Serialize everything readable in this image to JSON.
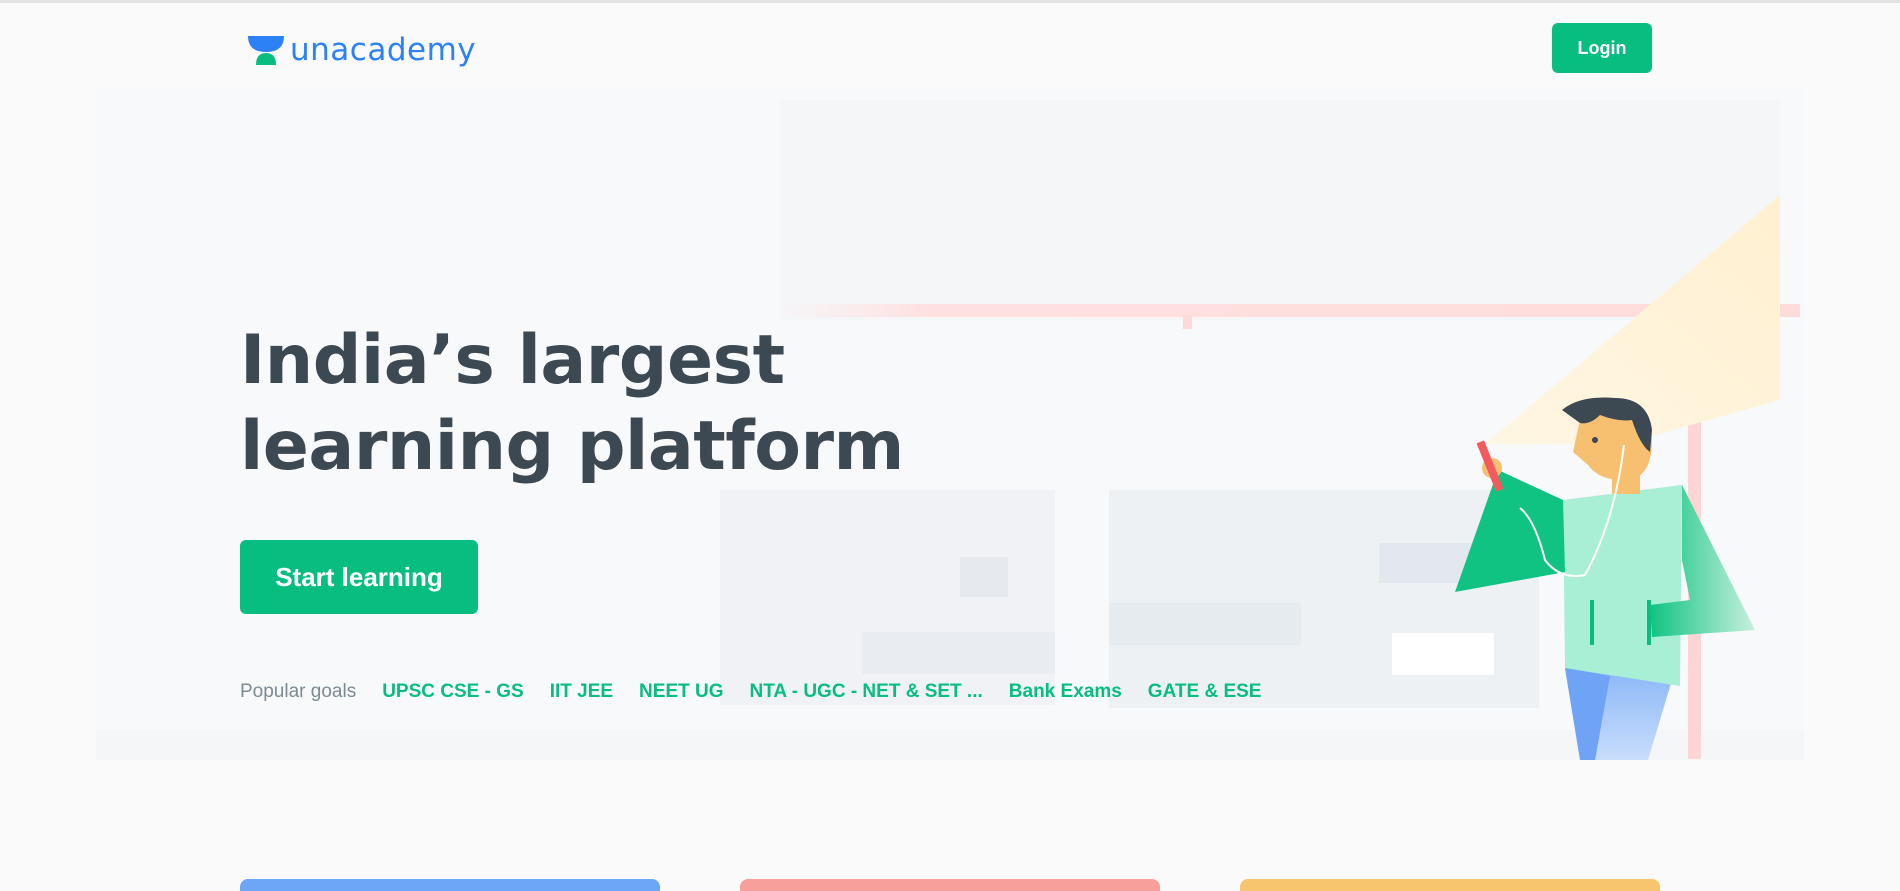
{
  "header": {
    "logo_text": "unacademy",
    "logo_icon": "unacademy-logo-icon",
    "login_label": "Login"
  },
  "hero": {
    "headline_line1": "India’s largest",
    "headline_line2": "learning platform",
    "cta_label": "Start learning",
    "illustration": "student-with-phone-illustration"
  },
  "goals": {
    "label": "Popular goals",
    "items": [
      "UPSC CSE - GS",
      "IIT JEE",
      "NEET UG",
      "NTA - UGC - NET & SET ...",
      "Bank Exams",
      "GATE & ESE"
    ]
  },
  "cards": {
    "colors": [
      "#6ea6f7",
      "#f79f9b",
      "#f7c56e"
    ]
  },
  "colors": {
    "brand_green": "#08bd80",
    "brand_blue": "#2d81f7",
    "text_dark": "#3c4852",
    "text_muted": "#7a8b94"
  }
}
